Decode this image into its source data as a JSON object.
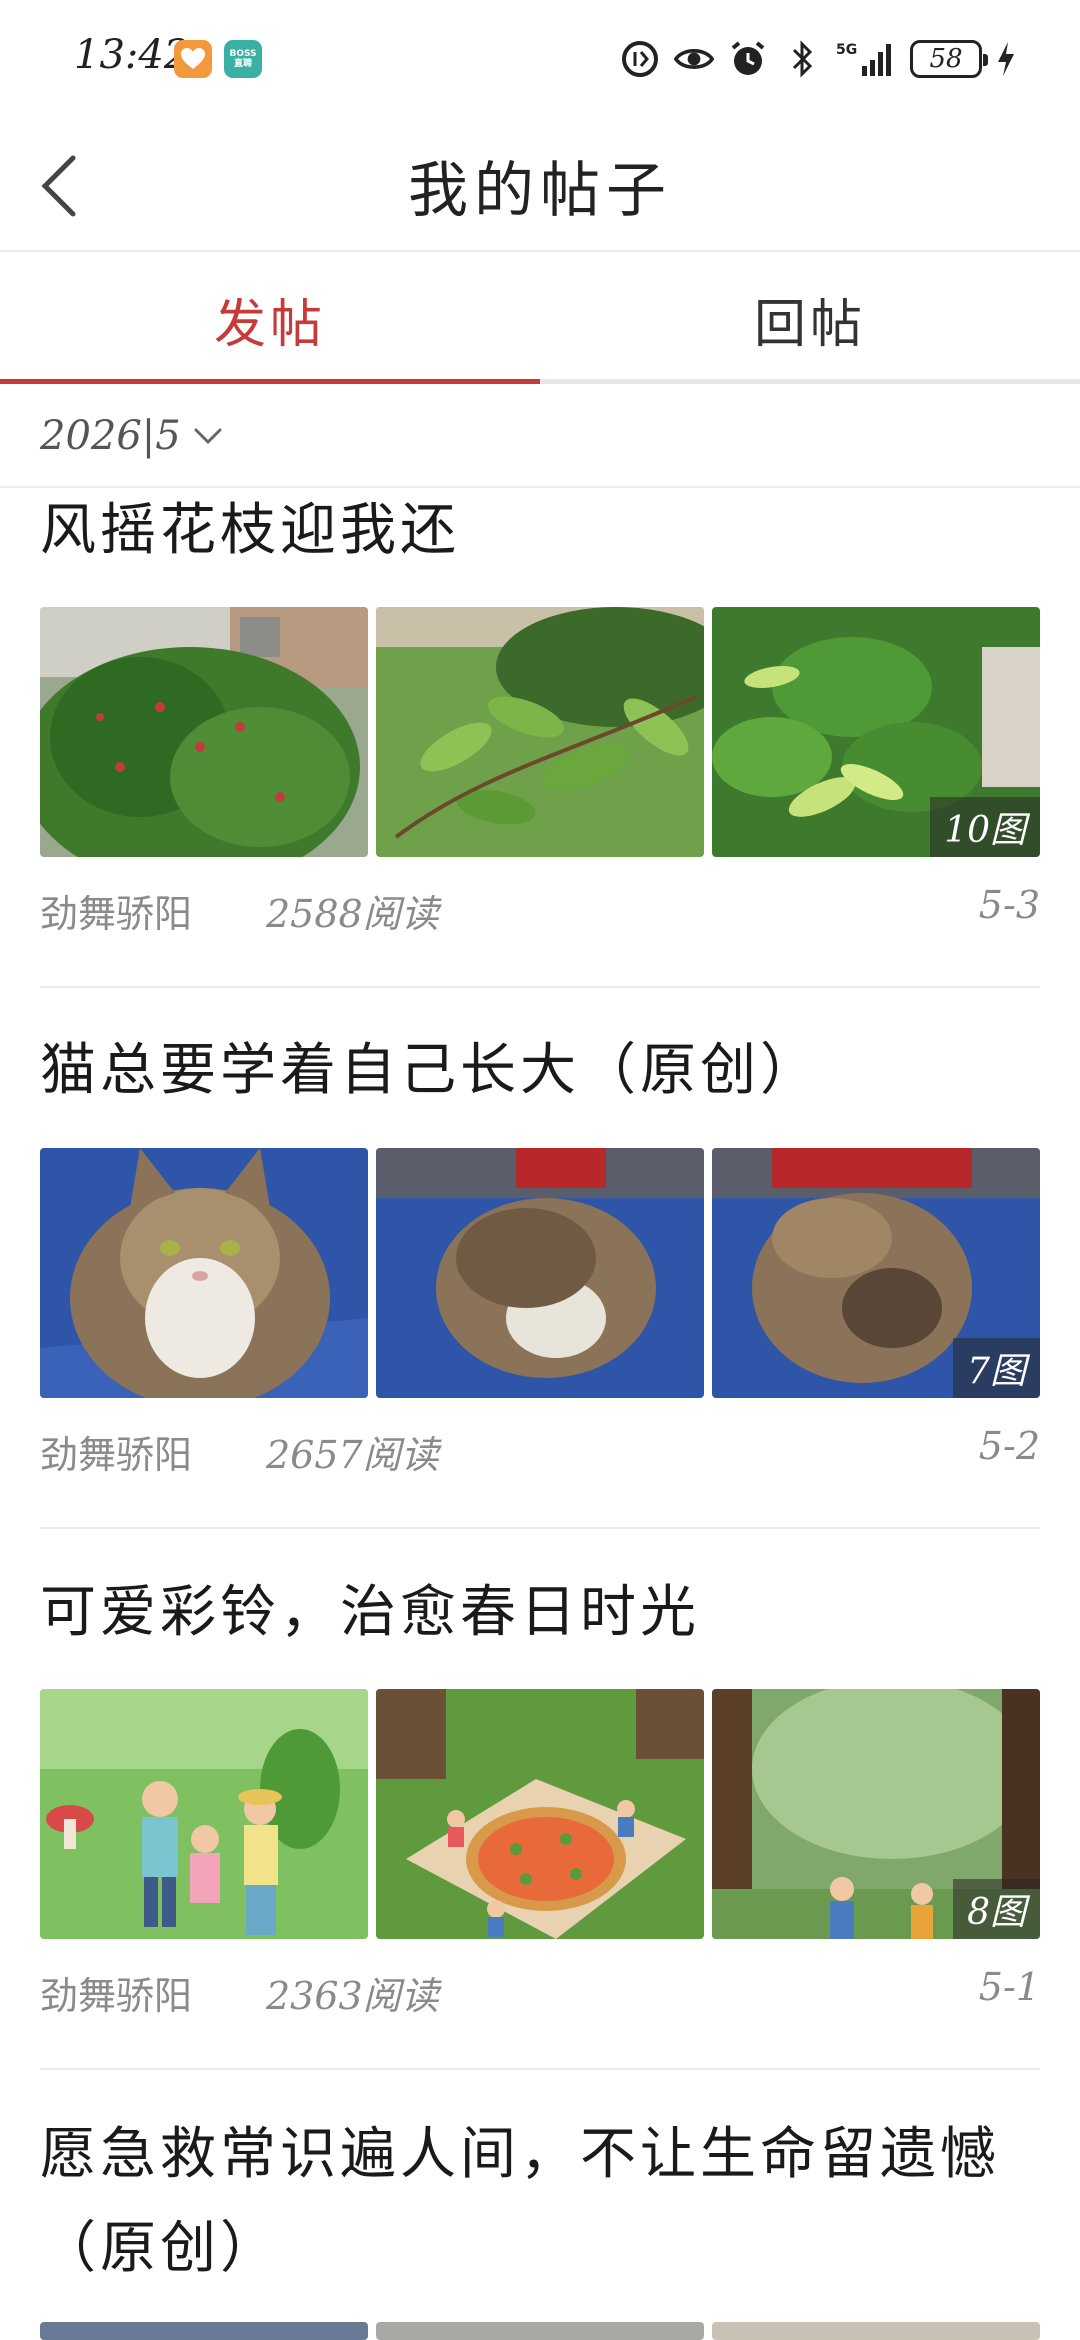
{
  "status_bar": {
    "time": "13:42",
    "apps": [
      "heart-app-icon",
      "boss-app-icon"
    ],
    "boss_label_1": "BOSS",
    "boss_label_2": "直聘",
    "network": "5G",
    "battery": "58"
  },
  "header": {
    "title": "我的帖子"
  },
  "tabs": [
    {
      "label": "发帖",
      "active": true
    },
    {
      "label": "回帖",
      "active": false
    }
  ],
  "filter": {
    "date": "2026|5"
  },
  "colors": {
    "accent": "#c73a3a",
    "meta_text": "#8a8a8a"
  },
  "posts": [
    {
      "title": "风摇花枝迎我还",
      "image_count": "10图",
      "author": "劲舞骄阳",
      "reads": "2588阅读",
      "date": "5-3"
    },
    {
      "title": "猫总要学着自己长大（原创）",
      "image_count": "7图",
      "author": "劲舞骄阳",
      "reads": "2657阅读",
      "date": "5-2"
    },
    {
      "title": "可爱彩铃，治愈春日时光",
      "image_count": "8图",
      "author": "劲舞骄阳",
      "reads": "2363阅读",
      "date": "5-1"
    },
    {
      "title": "愿急救常识遍人间，不让生命留遗憾（原创）"
    }
  ]
}
